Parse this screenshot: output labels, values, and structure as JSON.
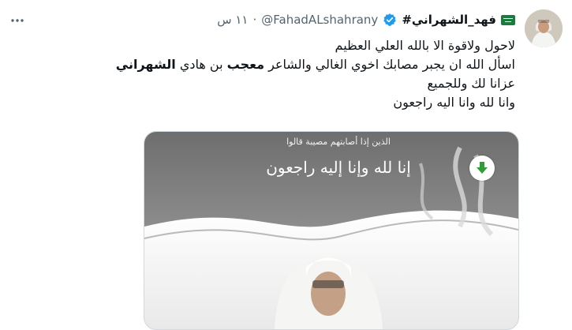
{
  "tweet": {
    "author_name": "فهد_الشهراني#",
    "flag_icon": "saudi-flag-icon",
    "verified_icon": "verified-badge-icon",
    "handle": "@FahadALshahrany",
    "separator": "·",
    "time": "١١ س",
    "more_icon": "more-options-icon",
    "lines": {
      "l1": "لاحول ولاقوة الا بالله العلي العظيم",
      "l2_a": "اسأل الله ان يجبر مصابك اخوي الغالي والشاعر",
      "l2_b": "معجب",
      "l2_c": "بن هادي",
      "l2_d": "الشهراني",
      "l3": "عزانا لك وللجميع",
      "l4": "وانا لله وانا اليه راجعون"
    },
    "media": {
      "top_text": "الذين إذا أصابتهم مصيبة قالوا",
      "main_text": "إنا لله وإنا إليه راجعون",
      "download_icon": "download-arrow-icon"
    },
    "colors": {
      "accent": "#1d9bf0",
      "text": "#0f1419",
      "muted": "#536471",
      "flag": "#1b7a3e",
      "download": "#2e9d37"
    }
  }
}
